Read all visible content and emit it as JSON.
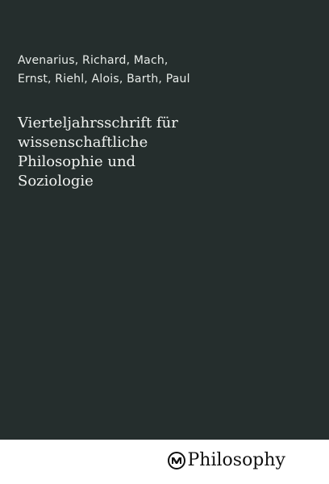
{
  "book": {
    "authors": [
      "Avenarius, Richard, Mach,",
      "Ernst, Riehl, Alois, Barth, Paul"
    ],
    "title": [
      "Vierteljahrsschrift für",
      "wissenschaftliche",
      "Philosophie und",
      "Soziologie"
    ]
  },
  "publisher": {
    "logo_icon": "mv-logo-icon",
    "name": "Philosophy"
  },
  "colors": {
    "panel": "#252e2d",
    "background": "#ffffff",
    "cover_text": "#f1f3f1",
    "publisher_text": "#111111"
  }
}
